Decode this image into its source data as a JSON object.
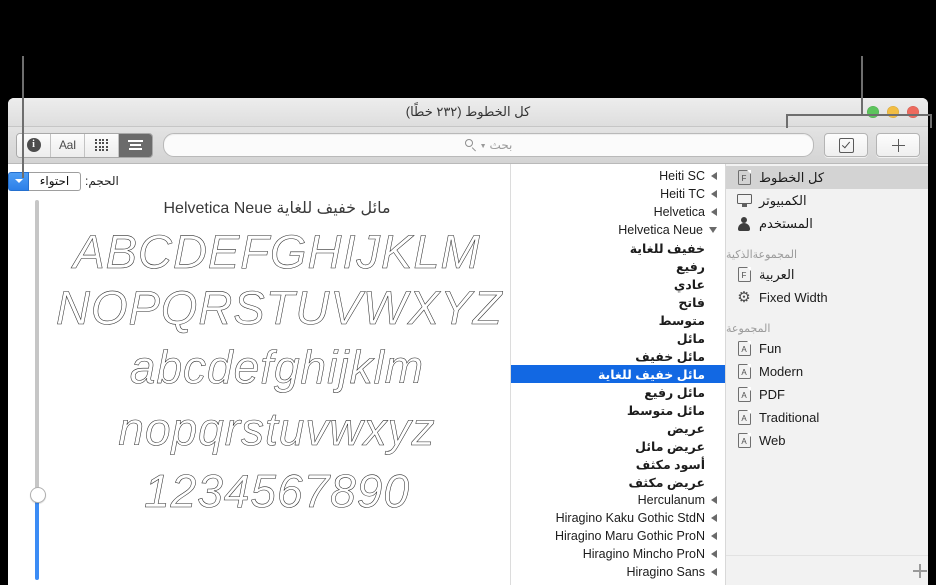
{
  "window": {
    "title": "كل الخطوط (٢٣٢ خطًا)",
    "traffic_lights": [
      "green",
      "yellow",
      "red"
    ]
  },
  "toolbar": {
    "add_label": "+",
    "validate_label": "✓",
    "search": {
      "placeholder": "بحث",
      "icon": "search-icon"
    },
    "view_segments": [
      {
        "name": "info",
        "label": "i",
        "selected": false
      },
      {
        "name": "typography",
        "label": "AaI",
        "selected": false
      },
      {
        "name": "repertoire",
        "label": "grid",
        "selected": false
      },
      {
        "name": "list",
        "label": "list",
        "selected": true
      }
    ]
  },
  "sidebar": {
    "items": [
      {
        "label": "كل الخطوط",
        "icon": "font-book-icon",
        "icon_letter": "F",
        "type": "row",
        "selected": true
      },
      {
        "label": "الكمبيوتر",
        "icon": "monitor-icon",
        "type": "row",
        "selected": false
      },
      {
        "label": "المستخدم",
        "icon": "person-icon",
        "type": "row",
        "selected": false
      },
      {
        "label": "المجموعةالذكية",
        "type": "header"
      },
      {
        "label": "العربية",
        "icon": "font-book-icon",
        "icon_letter": "F",
        "type": "row",
        "selected": false
      },
      {
        "label": "Fixed Width",
        "icon": "gear-icon",
        "type": "row",
        "selected": false
      },
      {
        "label": "المجموعة",
        "type": "header"
      },
      {
        "label": "Fun",
        "icon": "collection-icon",
        "icon_letter": "A",
        "type": "row",
        "selected": false
      },
      {
        "label": "Modern",
        "icon": "collection-icon",
        "icon_letter": "A",
        "type": "row",
        "selected": false
      },
      {
        "label": "PDF",
        "icon": "collection-icon",
        "icon_letter": "A",
        "type": "row",
        "selected": false
      },
      {
        "label": "Traditional",
        "icon": "collection-icon",
        "icon_letter": "A",
        "type": "row",
        "selected": false
      },
      {
        "label": "Web",
        "icon": "collection-icon",
        "icon_letter": "A",
        "type": "row",
        "selected": false
      }
    ],
    "add_button_label": "+"
  },
  "font_list": [
    {
      "label": "Heiti SC",
      "state": "collapsed",
      "member": false,
      "selected": false
    },
    {
      "label": "Heiti TC",
      "state": "collapsed",
      "member": false,
      "selected": false
    },
    {
      "label": "Helvetica",
      "state": "collapsed",
      "member": false,
      "selected": false
    },
    {
      "label": "Helvetica Neue",
      "state": "expanded",
      "member": false,
      "selected": false
    },
    {
      "label": "خفيف للغاية",
      "state": "none",
      "member": true,
      "selected": false
    },
    {
      "label": "رفيع",
      "state": "none",
      "member": true,
      "selected": false
    },
    {
      "label": "عادي",
      "state": "none",
      "member": true,
      "selected": false
    },
    {
      "label": "فاتح",
      "state": "none",
      "member": true,
      "selected": false
    },
    {
      "label": "متوسط",
      "state": "none",
      "member": true,
      "selected": false
    },
    {
      "label": "مائل",
      "state": "none",
      "member": true,
      "selected": false
    },
    {
      "label": "مائل خفيف",
      "state": "none",
      "member": true,
      "selected": false
    },
    {
      "label": "مائل خفيف للغاية",
      "state": "none",
      "member": true,
      "selected": true
    },
    {
      "label": "مائل رفيع",
      "state": "none",
      "member": true,
      "selected": false
    },
    {
      "label": "مائل متوسط",
      "state": "none",
      "member": true,
      "selected": false
    },
    {
      "label": "عريض",
      "state": "none",
      "member": true,
      "selected": false
    },
    {
      "label": "عريض مائل",
      "state": "none",
      "member": true,
      "selected": false
    },
    {
      "label": "أسود مكثف",
      "state": "none",
      "member": true,
      "selected": false
    },
    {
      "label": "عريض مكثف",
      "state": "none",
      "member": true,
      "selected": false
    },
    {
      "label": "Herculanum",
      "state": "collapsed",
      "member": false,
      "selected": false
    },
    {
      "label": "Hiragino Kaku Gothic StdN",
      "state": "collapsed",
      "member": false,
      "selected": false
    },
    {
      "label": "Hiragino Maru Gothic ProN",
      "state": "collapsed",
      "member": false,
      "selected": false
    },
    {
      "label": "Hiragino Mincho ProN",
      "state": "collapsed",
      "member": false,
      "selected": false
    },
    {
      "label": "Hiragino Sans",
      "state": "collapsed",
      "member": false,
      "selected": false
    }
  ],
  "preview": {
    "size_label": "الحجم:",
    "size_value": "احتواء",
    "specimen_title": "مائل خفيف للغاية Helvetica Neue",
    "lines": {
      "upper1": "ABCDEFGHIJKLM",
      "upper2": "NOPQRSTUVWXYZ",
      "lower1": "abcdefghijklm",
      "lower2": "nopqrstuvwxyz",
      "digits": "1234567890"
    }
  },
  "colors": {
    "selection_blue": "#1268e3",
    "accent_blue": "#3b8cf5",
    "sidebar_bg": "#f2f2f2",
    "window_bg": "#ffffff",
    "callout": "#6e6e6e"
  }
}
